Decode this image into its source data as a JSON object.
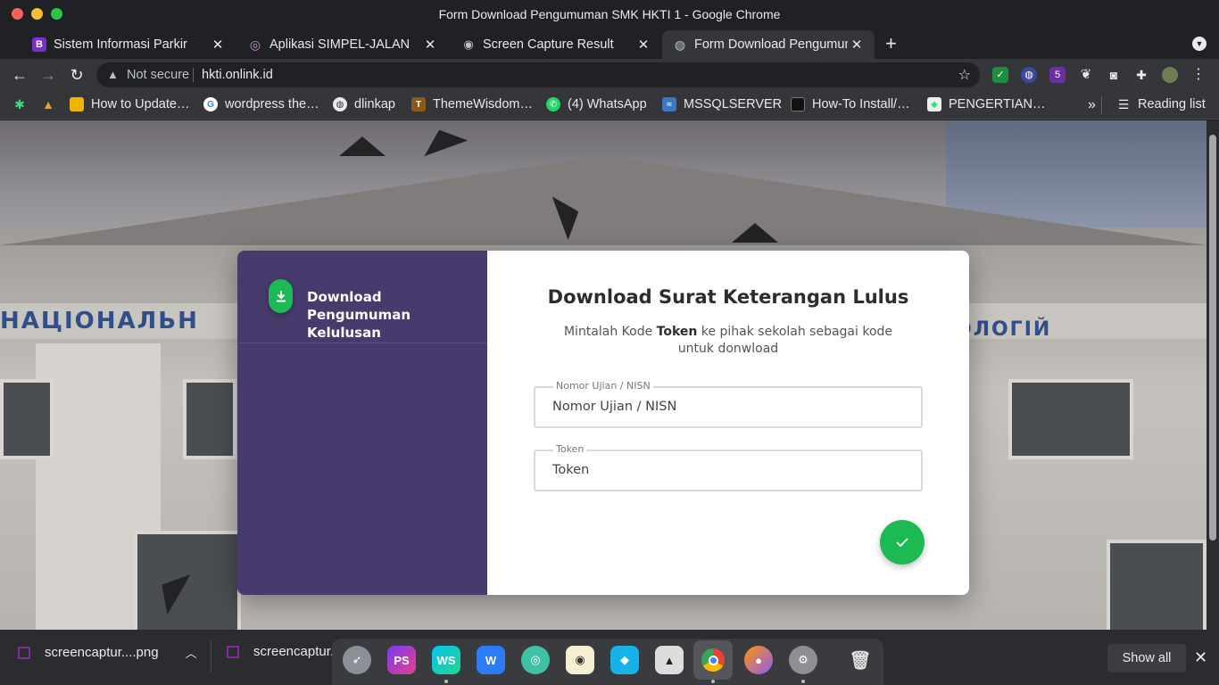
{
  "window": {
    "title": "Form Download Pengumuman SMK HKTI 1 - Google Chrome"
  },
  "tabs": [
    {
      "label": "Sistem Informasi Parkir",
      "icon": "bootstrap-icon",
      "color": "#7b2fc9"
    },
    {
      "label": "Aplikasi SIMPEL-JALAN",
      "icon": "globe-icon",
      "color": "#c98bd6"
    },
    {
      "label": "Screen Capture Result",
      "icon": "camera-icon",
      "color": "#bdc1c6"
    },
    {
      "label": "Form Download Pengumuman SMK HKTI 1",
      "icon": "globe-icon",
      "color": "#bdc1c6",
      "active": true
    }
  ],
  "toolbar": {
    "security_text": "Not secure",
    "url": "hkti.onlink.id",
    "ext_badge": "5"
  },
  "bookmarks": [
    {
      "label": "How to Update…",
      "icon": "folder-icon"
    },
    {
      "label": "wordpress the…",
      "icon": "google-icon"
    },
    {
      "label": "dlinkap",
      "icon": "globe-icon"
    },
    {
      "label": "ThemeWisdom…",
      "icon": "themewisdom-icon"
    },
    {
      "label": "(4) WhatsApp",
      "icon": "whatsapp-icon"
    },
    {
      "label": "MSSQLSERVER",
      "icon": "mssql-icon"
    },
    {
      "label": "How-To Install/…",
      "icon": "bookmark-icon"
    },
    {
      "label": "PENGERTIAN…",
      "icon": "android-icon"
    }
  ],
  "bookmarks_more": "»",
  "reading_list": "Reading list",
  "page": {
    "background_banner_left": "НАЦІОНАЛЬН",
    "background_banner_right": "ОЛОГІЙ",
    "step": {
      "label_line1": "Download",
      "label_line2": "Pengumuman Kelulusan"
    },
    "form": {
      "title": "Download Surat Keterangan Lulus",
      "subtitle_prefix": "Mintalah Kode ",
      "subtitle_bold": "Token",
      "subtitle_suffix": " ke pihak sekolah sebagai kode untuk donwload",
      "nisn_label": "Nomor Ujian / NISN",
      "nisn_placeholder": "Nomor Ujian / NISN",
      "token_label": "Token",
      "token_placeholder": "Token"
    },
    "colors": {
      "sidebar": "#473a6c",
      "accent": "#1db954"
    }
  },
  "downloads": [
    {
      "label": "screencaptur....png"
    },
    {
      "label": "screencaptur..."
    }
  ],
  "downloads_show_all": "Show all",
  "dock_icons": [
    "launchpad-icon",
    "phpstorm-icon",
    "webstorm-icon",
    "wps-icon",
    "gitkraken-icon",
    "vlc-icon",
    "kodi-icon",
    "inkscape-icon",
    "chrome-icon",
    "firefox-icon",
    "settings-icon",
    "trash-icon"
  ]
}
